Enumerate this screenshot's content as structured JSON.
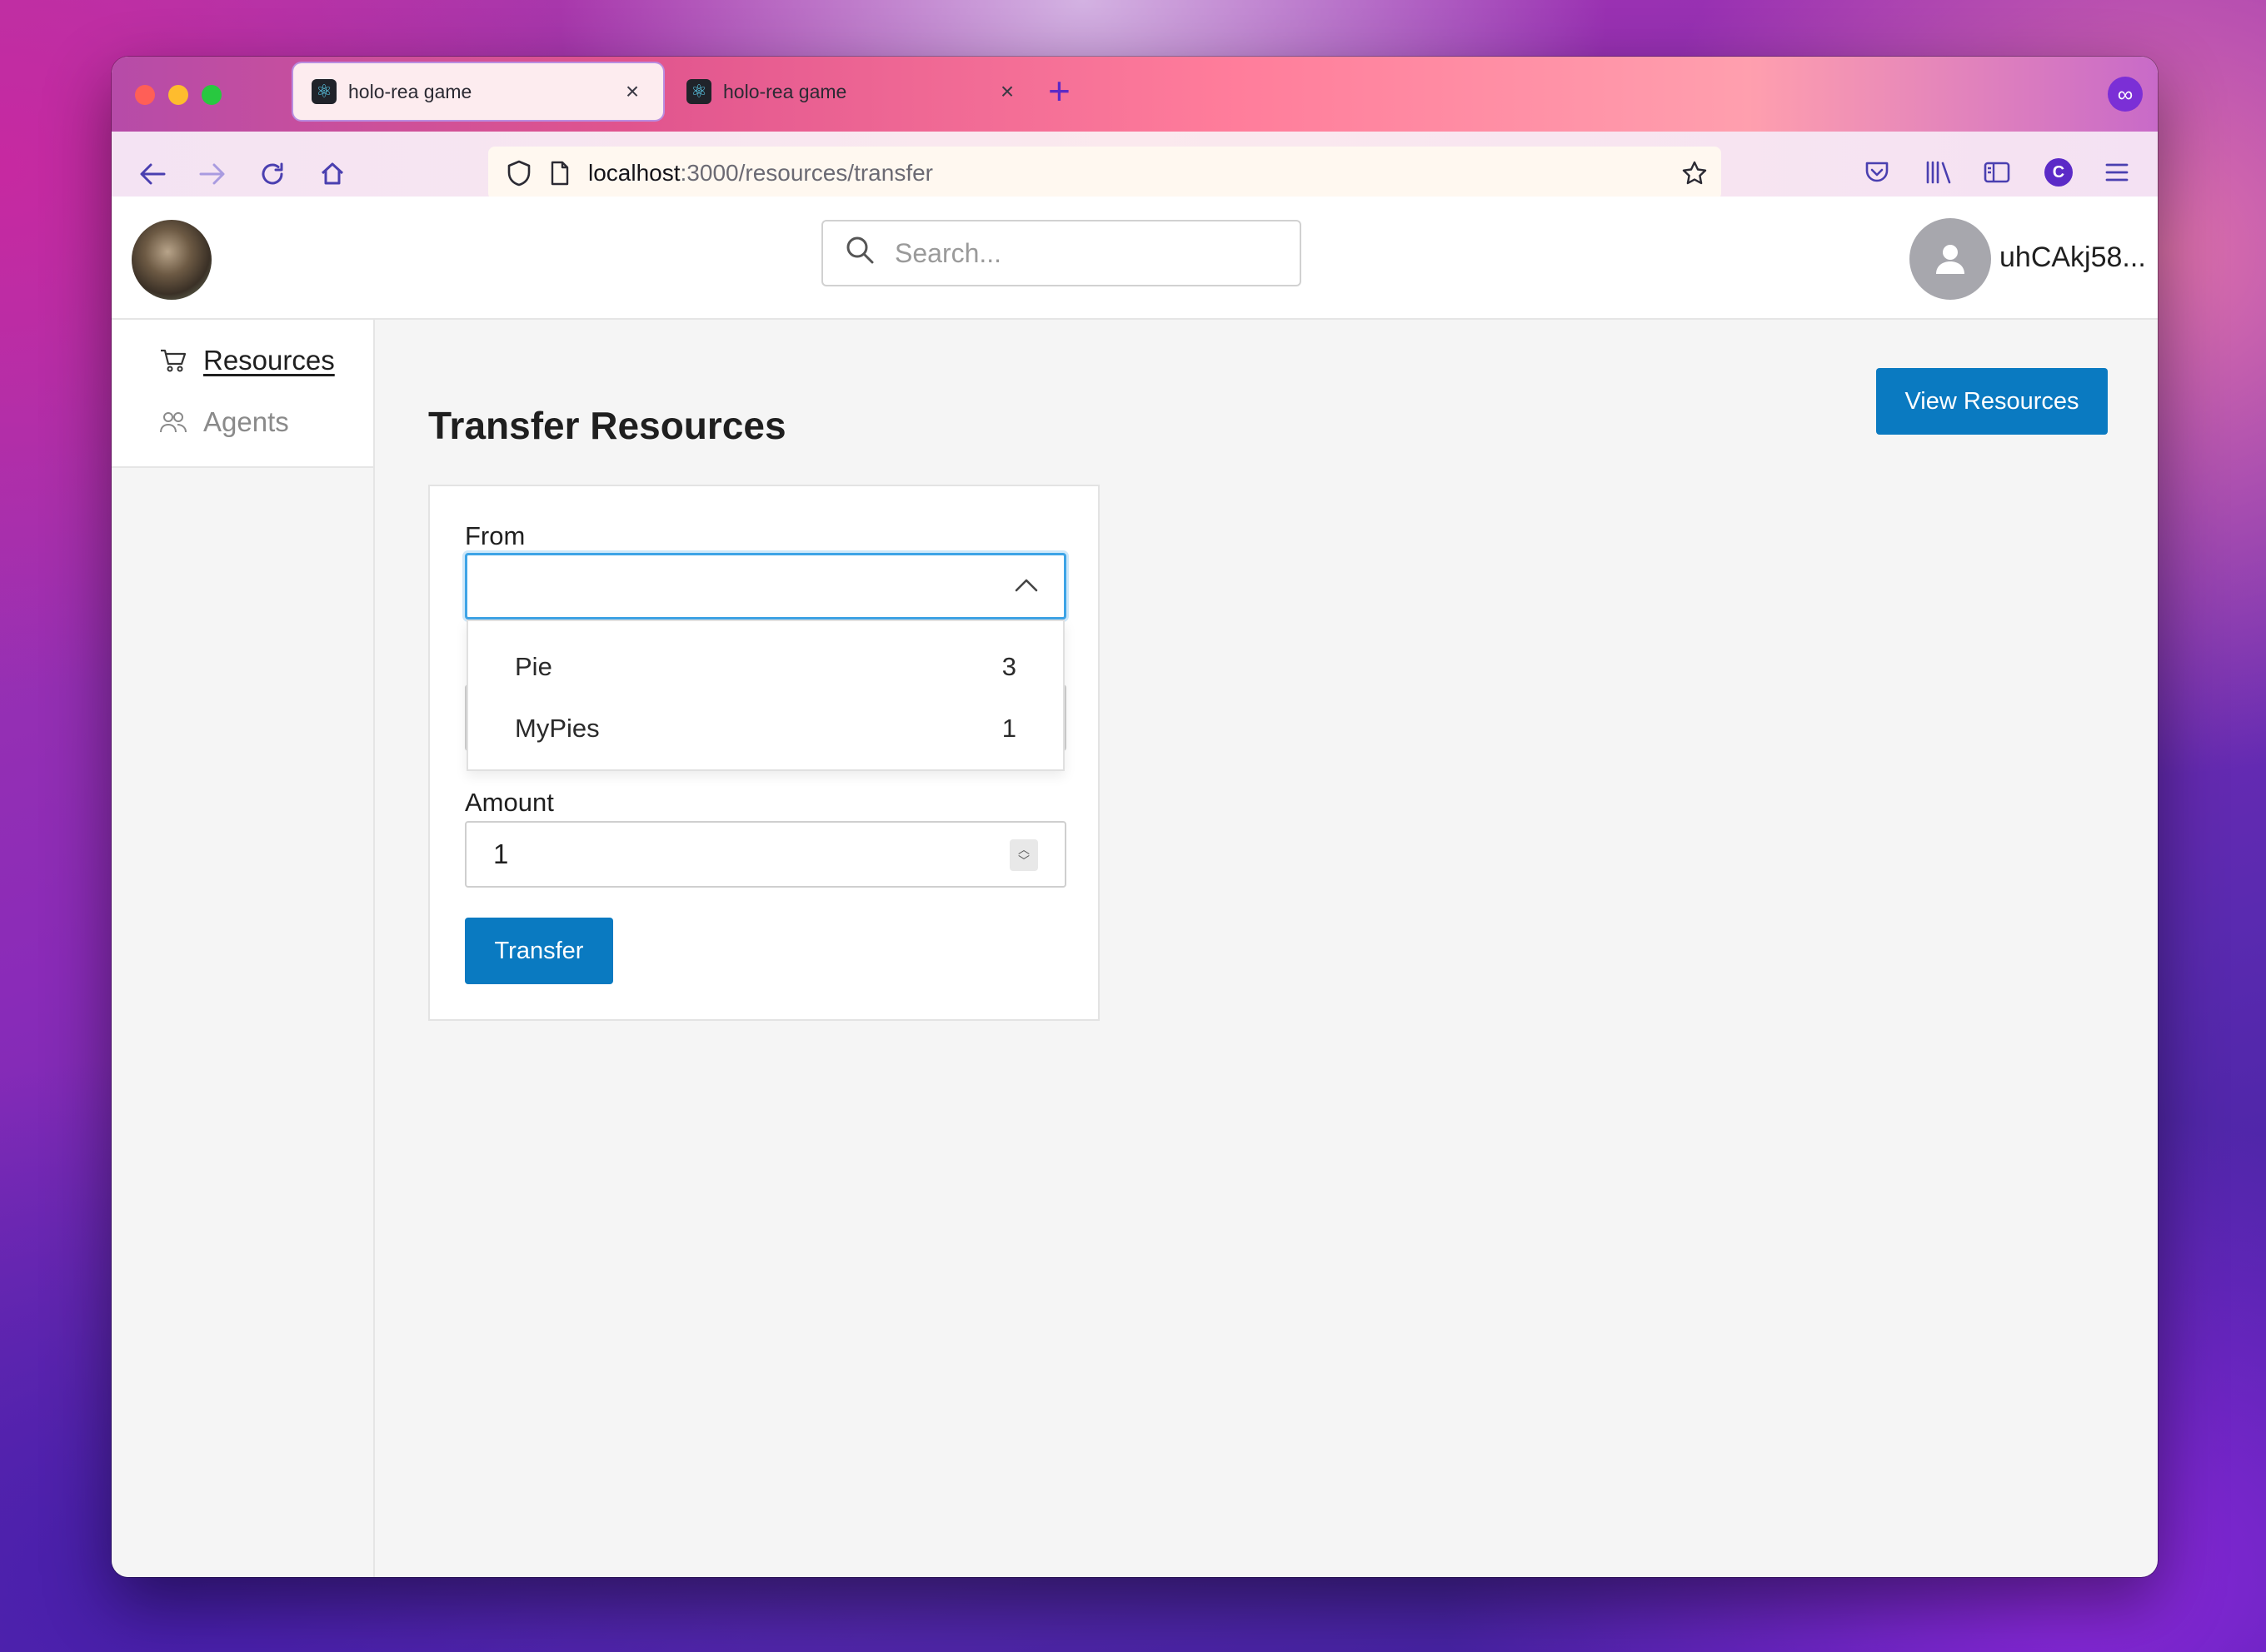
{
  "browser": {
    "tabs": [
      {
        "title": "holo-rea game",
        "active": true
      },
      {
        "title": "holo-rea game",
        "active": false
      }
    ],
    "url_host": "localhost",
    "url_path": ":3000/resources/transfer",
    "profile_initial": "C"
  },
  "header": {
    "search_placeholder": "Search...",
    "username": "uhCAkj58..."
  },
  "sidebar": {
    "items": [
      {
        "label": "Resources",
        "icon": "cart-icon",
        "active": true
      },
      {
        "label": "Agents",
        "icon": "users-icon",
        "active": false
      }
    ]
  },
  "page": {
    "title": "Transfer Resources",
    "view_resources_label": "View Resources"
  },
  "form": {
    "from_label": "From",
    "from_value": "",
    "options": [
      {
        "label": "Pie",
        "count": "3"
      },
      {
        "label": "MyPies",
        "count": "1"
      }
    ],
    "amount_label": "Amount",
    "amount_value": "1",
    "submit_label": "Transfer"
  },
  "colors": {
    "primary_button": "#0a7ac1",
    "focus_ring": "#3ea4e6",
    "browser_accent": "#5b2ac7"
  }
}
